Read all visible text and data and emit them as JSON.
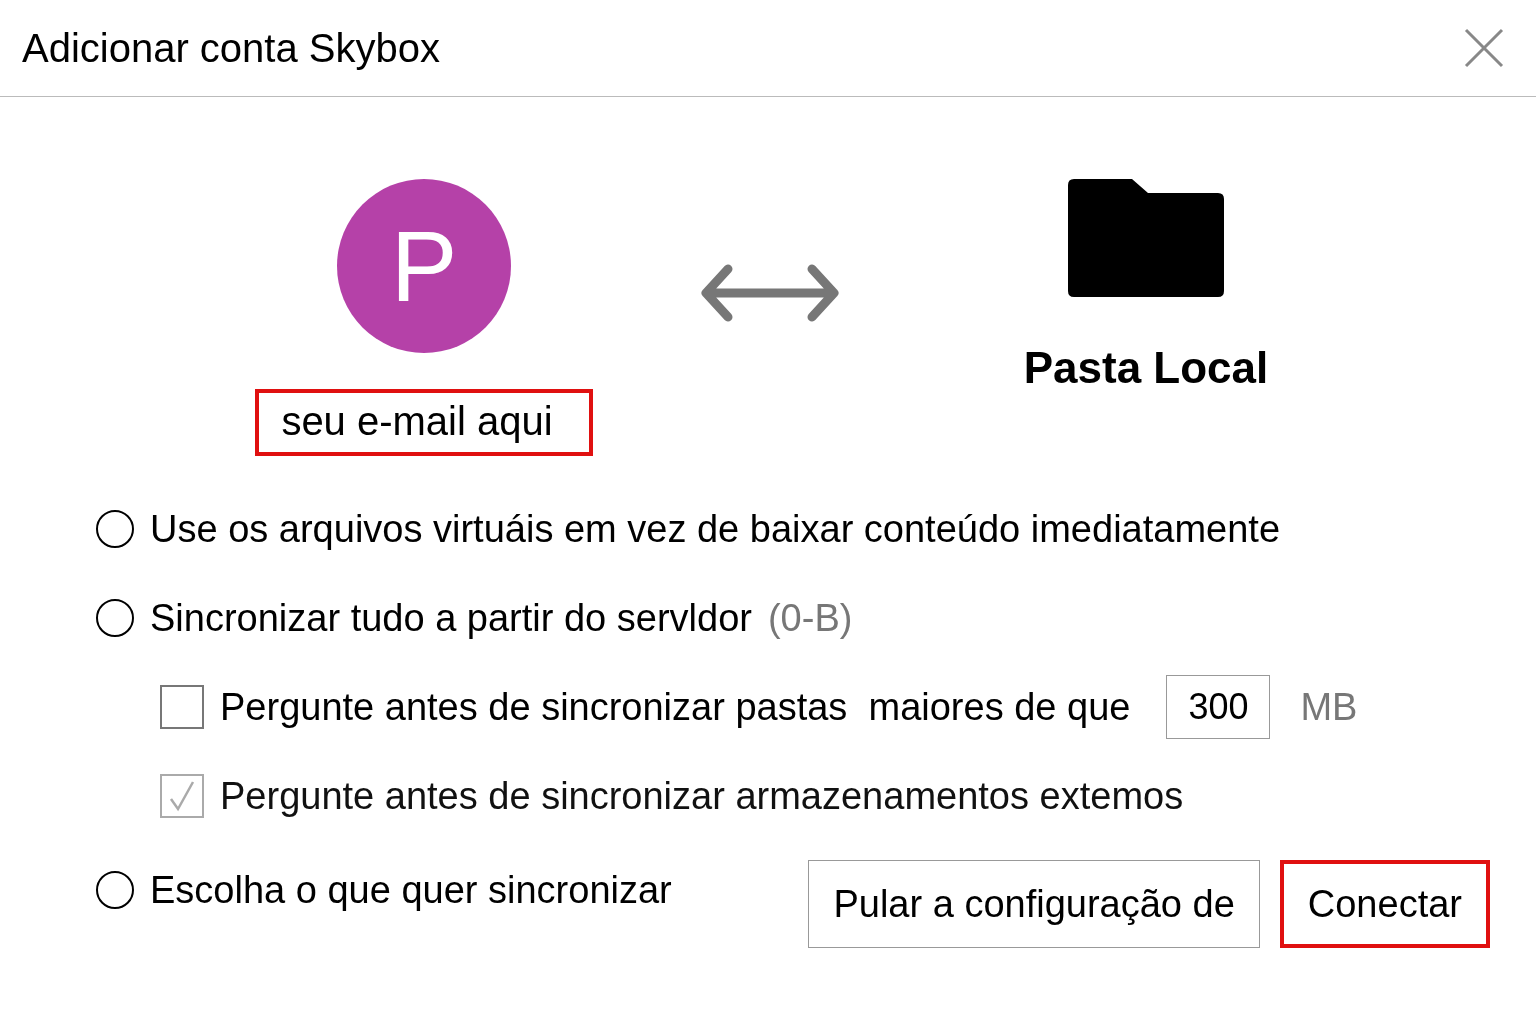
{
  "window": {
    "title": "Adicionar conta Skybox"
  },
  "account": {
    "initial": "P",
    "color": "#b541a8",
    "email": "seu e-mail aqui",
    "email_highlighted": true
  },
  "local_folder": {
    "label": "Pasta Local"
  },
  "options": [
    {
      "kind": "radio",
      "label": "Use os arquivos virtuáis em vez de baixar conteúdo imediatamente",
      "selected": false
    },
    {
      "kind": "radio",
      "label": "Sincronizar tudo a partir do servldor",
      "note": "(0-B)",
      "selected": false
    },
    {
      "kind": "checkbox",
      "label": "Pergunte antes de sincronizar pastas  maiores de que",
      "checked": false,
      "disabled": false,
      "value": "300",
      "unit": "MB"
    },
    {
      "kind": "checkbox",
      "label": "Pergunte antes de sincronizar armazenamentos extemos",
      "checked": true,
      "disabled": true
    }
  ],
  "last_option": {
    "kind": "radio",
    "label": "Escolha o que quer sincronizar",
    "selected": false
  },
  "buttons": [
    {
      "label": "Pular a configuração de",
      "highlighted": false
    },
    {
      "label": "Conectar",
      "highlighted": true
    }
  ]
}
